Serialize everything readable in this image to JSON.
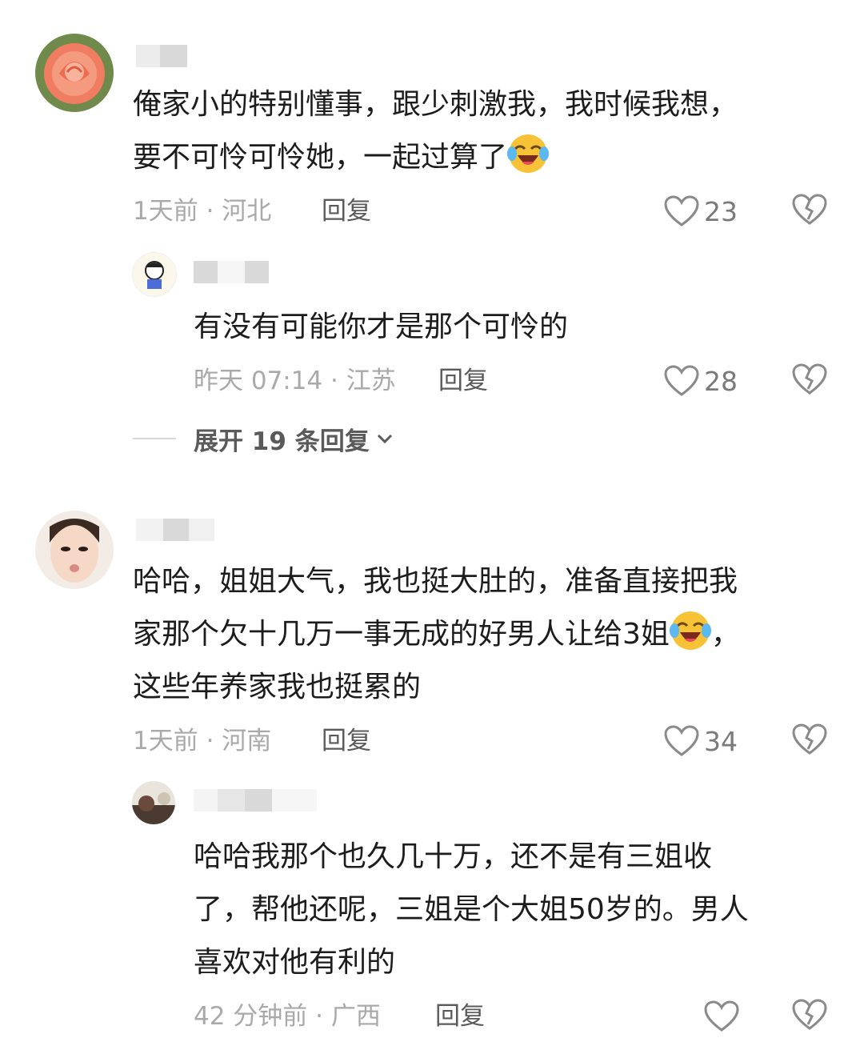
{
  "comments": [
    {
      "text": "俺家小的特别懂事，跟少刺激我，我时候我想，\n要不可怜可怜她，一起过算了",
      "emoji": "laugh-cry-emoji",
      "meta": "1天前 · 河北",
      "reply_label": "回复",
      "likes": "23",
      "reply": {
        "text": "有没有可能你才是那个可怜的",
        "meta": "昨天 07:14 · 江苏",
        "reply_label": "回复",
        "likes": "28"
      },
      "expand_label": "展开 19 条回复"
    },
    {
      "text_lines": [
        "哈哈，姐姐大气，我也挺大肚的，准备直接把我",
        "家那个欠十几万一事无成的好男人让给3姐",
        "，",
        "这些年养家我也挺累的"
      ],
      "emoji": "laugh-cry-emoji",
      "meta": "1天前 · 河南",
      "reply_label": "回复",
      "likes": "34",
      "reply": {
        "text": "哈哈我那个也久几十万，还不是有三姐收\n了，帮他还呢，三姐是个大姐50岁的。男人\n喜欢对他有利的",
        "meta": "42 分钟前 · 广西",
        "reply_label": "回复"
      }
    }
  ],
  "colors": {
    "meta_gray": "#a9a9a9",
    "action_gray": "#5a5a5a",
    "text": "#1c1c1c",
    "emoji_yellow": "#f7c236"
  }
}
